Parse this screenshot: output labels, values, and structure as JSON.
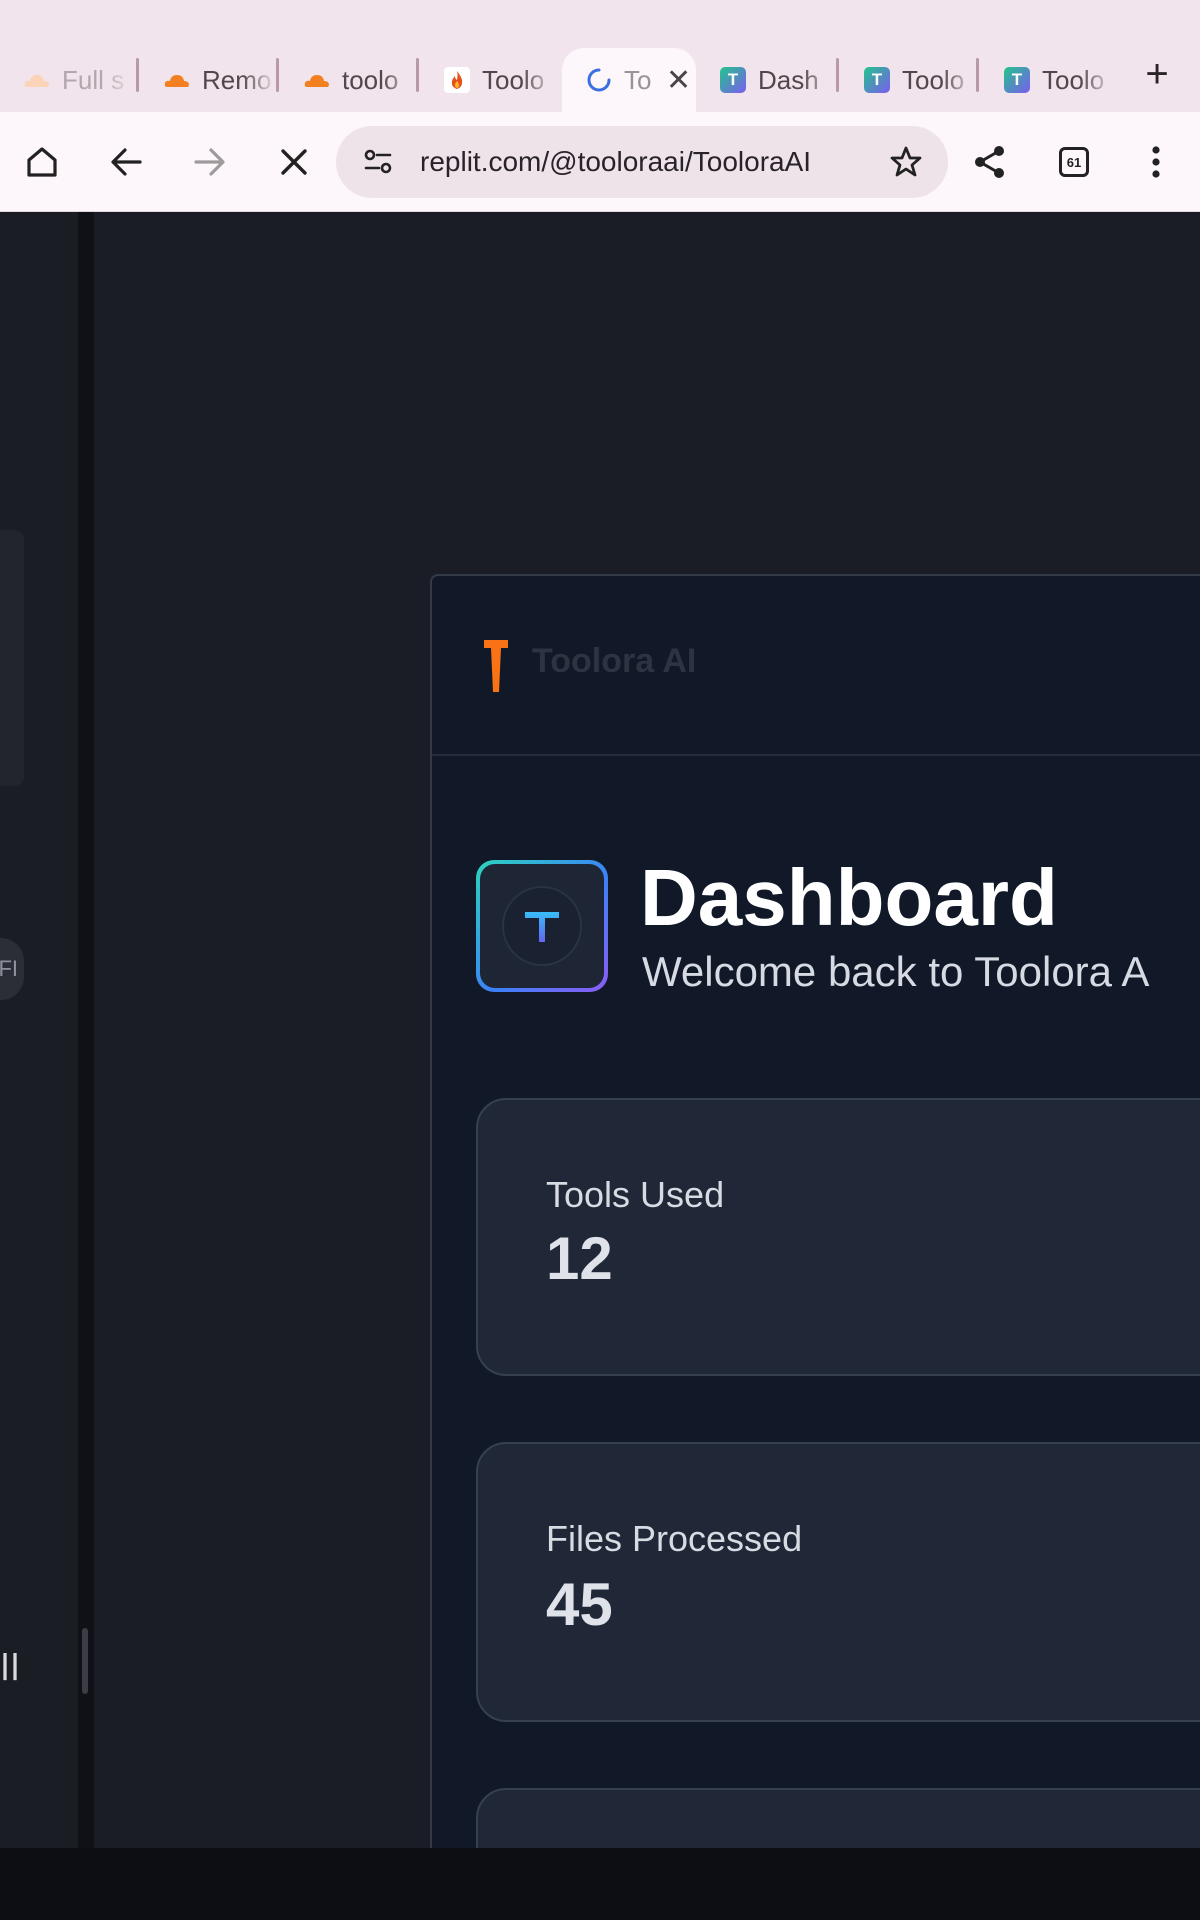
{
  "browser": {
    "tabs": [
      {
        "label": "Full s",
        "favicon": "cloudflare-faded-icon"
      },
      {
        "label": "Remo",
        "favicon": "cloudflare-icon"
      },
      {
        "label": "toolo",
        "favicon": "cloudflare-icon"
      },
      {
        "label": "Toolo",
        "favicon": "fire-icon"
      },
      {
        "label": "To",
        "favicon": "loading-spinner-icon",
        "active": true
      },
      {
        "label": "Dash",
        "favicon": "toolora-t-icon"
      },
      {
        "label": "Toolo",
        "favicon": "toolora-t-icon"
      },
      {
        "label": "Toolo",
        "favicon": "toolora-t-icon"
      }
    ],
    "new_tab_glyph": "+",
    "close_glyph": "✕",
    "favicon_letter": "T",
    "url": "replit.com/@tooloraai/TooloraAI",
    "tab_count": "61"
  },
  "app": {
    "brand_name": "Toolora AI",
    "logo_letter": "T",
    "title": "Dashboard",
    "subtitle": "Welcome back to Toolora A",
    "stats": [
      {
        "label": "Tools Used",
        "value": "12"
      },
      {
        "label": "Files Processed",
        "value": "45"
      }
    ]
  },
  "side_panel": {
    "circle_text": "FI",
    "bottom_text": "ll"
  },
  "colors": {
    "accent_orange": "#f97316",
    "logo_gradient_start": "#2dd4bf",
    "logo_gradient_end": "#8b5cf6",
    "app_background": "#111827",
    "card_background": "#202838"
  }
}
